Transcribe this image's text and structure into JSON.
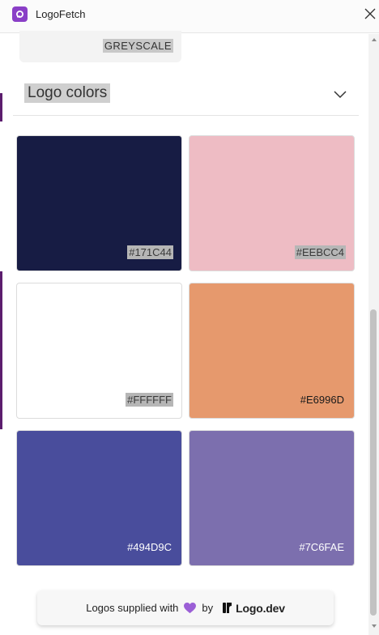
{
  "window": {
    "title": "LogoFetch"
  },
  "greyscale": {
    "label": "GREYSCALE"
  },
  "logo_colors": {
    "title": "Logo colors",
    "swatches": [
      {
        "hex": "#171C44",
        "color": "#171C44"
      },
      {
        "hex": "#EEBCC4",
        "color": "#EEBCC4"
      },
      {
        "hex": "#FFFFFF",
        "color": "#FFFFFF"
      },
      {
        "hex": "#E6996D",
        "color": "#E6996D"
      },
      {
        "hex": "#494D9C",
        "color": "#494D9C"
      },
      {
        "hex": "#7C6FAE",
        "color": "#7C6FAE"
      }
    ]
  },
  "footer": {
    "prefix": "Logos supplied with",
    "by": "by",
    "brand": "Logo.dev",
    "heart_icon": "purple-heart-icon"
  },
  "colors": {
    "accent": "#8A3FC7",
    "heart": "#9B5FD6"
  }
}
